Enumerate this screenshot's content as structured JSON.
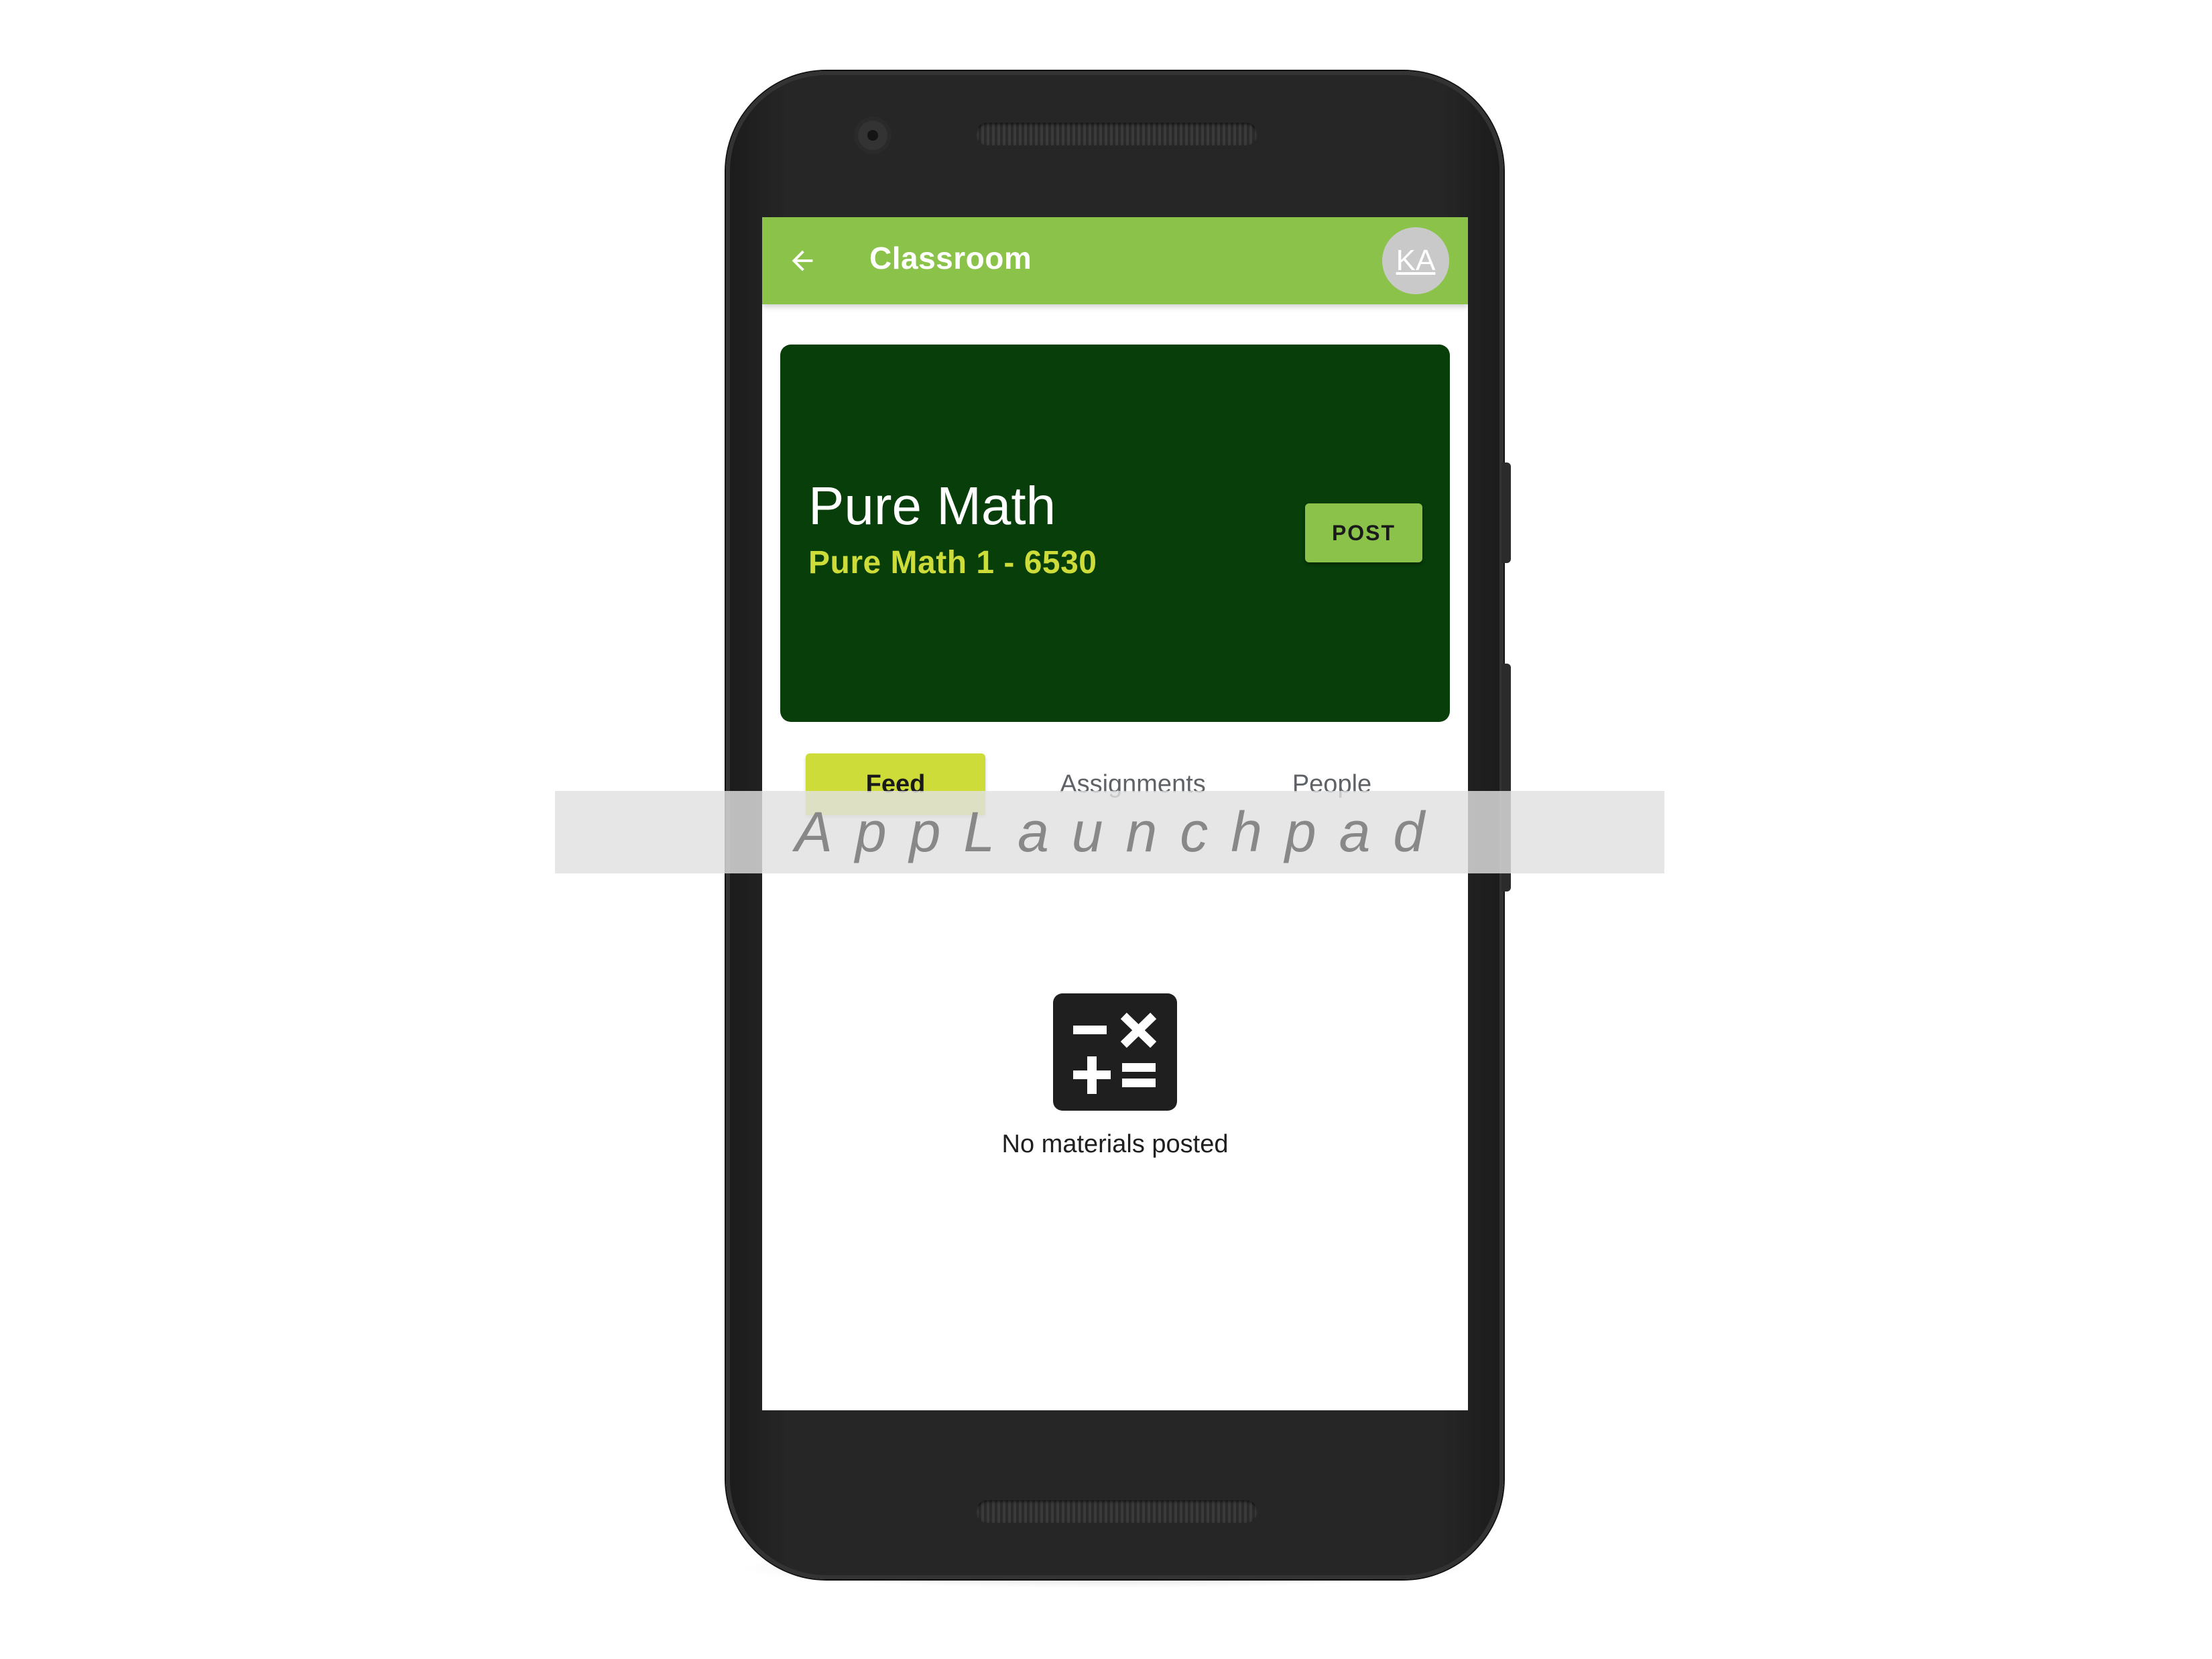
{
  "app_bar": {
    "title": "Classroom",
    "avatar_initials": "KA",
    "back_icon": "arrow-back-icon",
    "color": "#8bc34a"
  },
  "class_banner": {
    "title": "Pure Math",
    "subtitle": "Pure Math 1 - 6530",
    "post_label": "POST",
    "background_color": "#073e0a",
    "subtitle_color": "#cddc39"
  },
  "tabs": [
    {
      "label": "Feed",
      "active": true
    },
    {
      "label": "Assignments",
      "active": false
    },
    {
      "label": "People",
      "active": false
    }
  ],
  "empty_state": {
    "icon": "calculator-icon",
    "message": "No materials posted"
  },
  "watermark": {
    "text": "AppLaunchpad"
  }
}
